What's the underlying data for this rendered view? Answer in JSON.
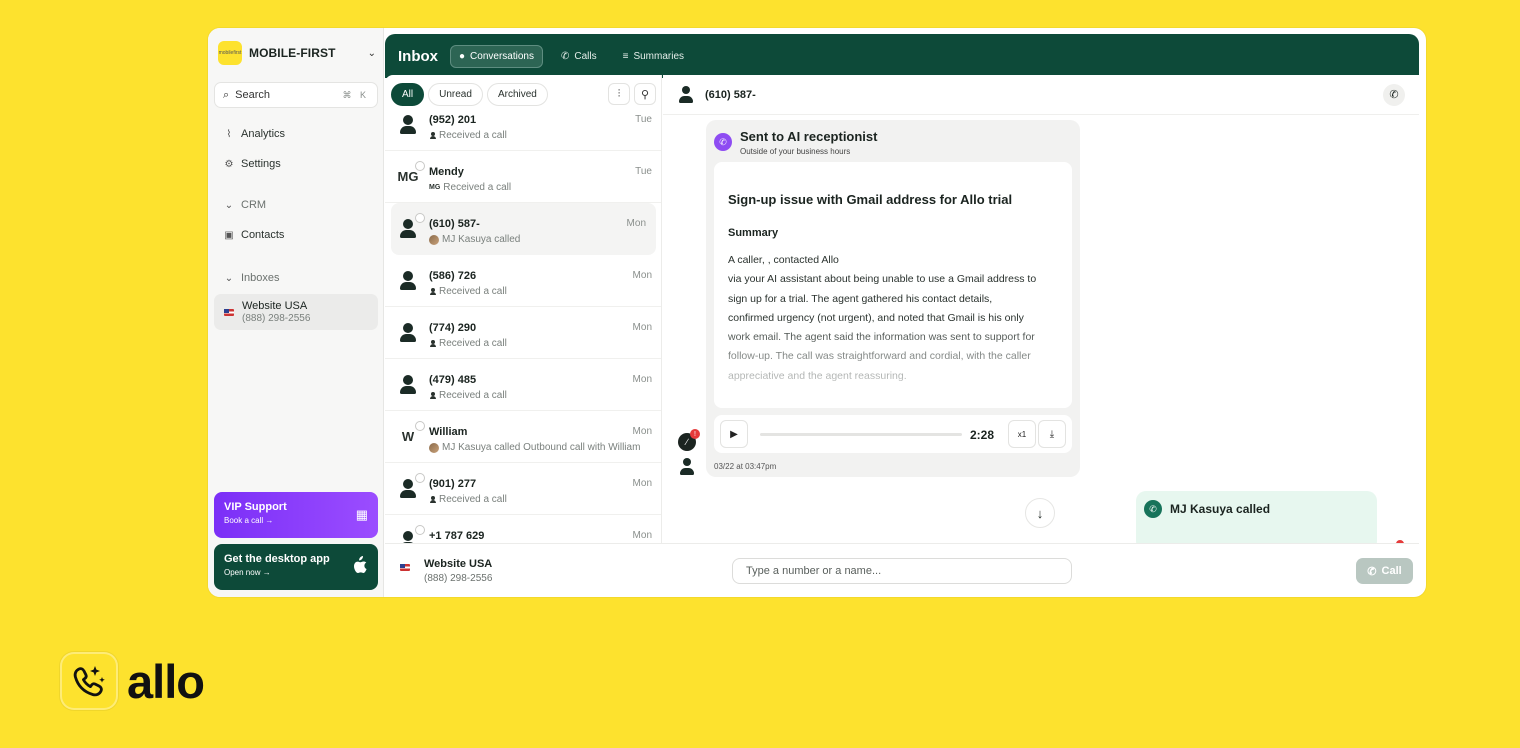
{
  "org": {
    "name": "MOBILE-FIRST",
    "logo_text": "mobilefirst"
  },
  "sidebar": {
    "search_label": "Search",
    "search_shortcut": "⌘ K",
    "analytics": "Analytics",
    "settings": "Settings",
    "crm": "CRM",
    "contacts": "Contacts",
    "inboxes": "Inboxes",
    "inbox_name": "Website USA",
    "inbox_number": "(888) 298-2556"
  },
  "promo": {
    "vip_title": "VIP Support",
    "vip_sub": "Book a call →",
    "desktop_title": "Get the desktop app",
    "desktop_sub": "Open now →"
  },
  "topbar": {
    "title": "Inbox",
    "tabs": [
      {
        "label": "Conversations",
        "icon": "chat-bubble-icon"
      },
      {
        "label": "Calls",
        "icon": "phone-icon"
      },
      {
        "label": "Summaries",
        "icon": "list-icon"
      }
    ]
  },
  "filters": {
    "all": "All",
    "unread": "Unread",
    "archived": "Archived"
  },
  "conversations": [
    {
      "name": "(952) 201",
      "sub": "Received a call",
      "when": "Tue"
    },
    {
      "name": "Mendy",
      "initials": "MG",
      "sub": "Received a call",
      "when": "Tue"
    },
    {
      "name": "(610) 587-",
      "sub": "MJ Kasuya called",
      "when": "Mon"
    },
    {
      "name": "(586) 726",
      "sub": "Received a call",
      "when": "Mon"
    },
    {
      "name": "(774) 290",
      "sub": "Received a call",
      "when": "Mon"
    },
    {
      "name": "(479) 485",
      "sub": "Received a call",
      "when": "Mon"
    },
    {
      "name": "William",
      "initials": "W",
      "sub": "MJ Kasuya called Outbound call with William",
      "when": "Mon"
    },
    {
      "name": "(901) 277",
      "sub": "Received a call",
      "when": "Mon"
    },
    {
      "name": "+1 787 629",
      "sub": "",
      "when": "Mon"
    }
  ],
  "thread": {
    "contact": "(610) 587-",
    "ai_title": "Sent to AI receptionist",
    "ai_sub": "Outside of your business hours",
    "summary_title": "Sign-up issue with Gmail address for Allo trial",
    "summary_heading": "Summary",
    "summary_text": "A caller,                                                , contacted Allo\nvia your AI assistant about being unable to use a Gmail address to\nsign up for a trial. The agent gathered his contact details,\nconfirmed urgency (not urgent), and noted that Gmail is his only\nwork email. The agent said the information was sent to support for\nfollow-up. The call was straightforward and cordial, with the caller\nappreciative and the agent reassuring.",
    "duration": "2:28",
    "speed": "x1",
    "timestamp": "03/22 at 03:47pm",
    "badge": "!",
    "call_card_title": "MJ Kasuya called"
  },
  "bottom": {
    "inbox_name": "Website USA",
    "inbox_number": "(888) 298-2556",
    "dial_placeholder": "Type a number or a name...",
    "call_label": "Call"
  },
  "brand": {
    "word": "allo"
  }
}
